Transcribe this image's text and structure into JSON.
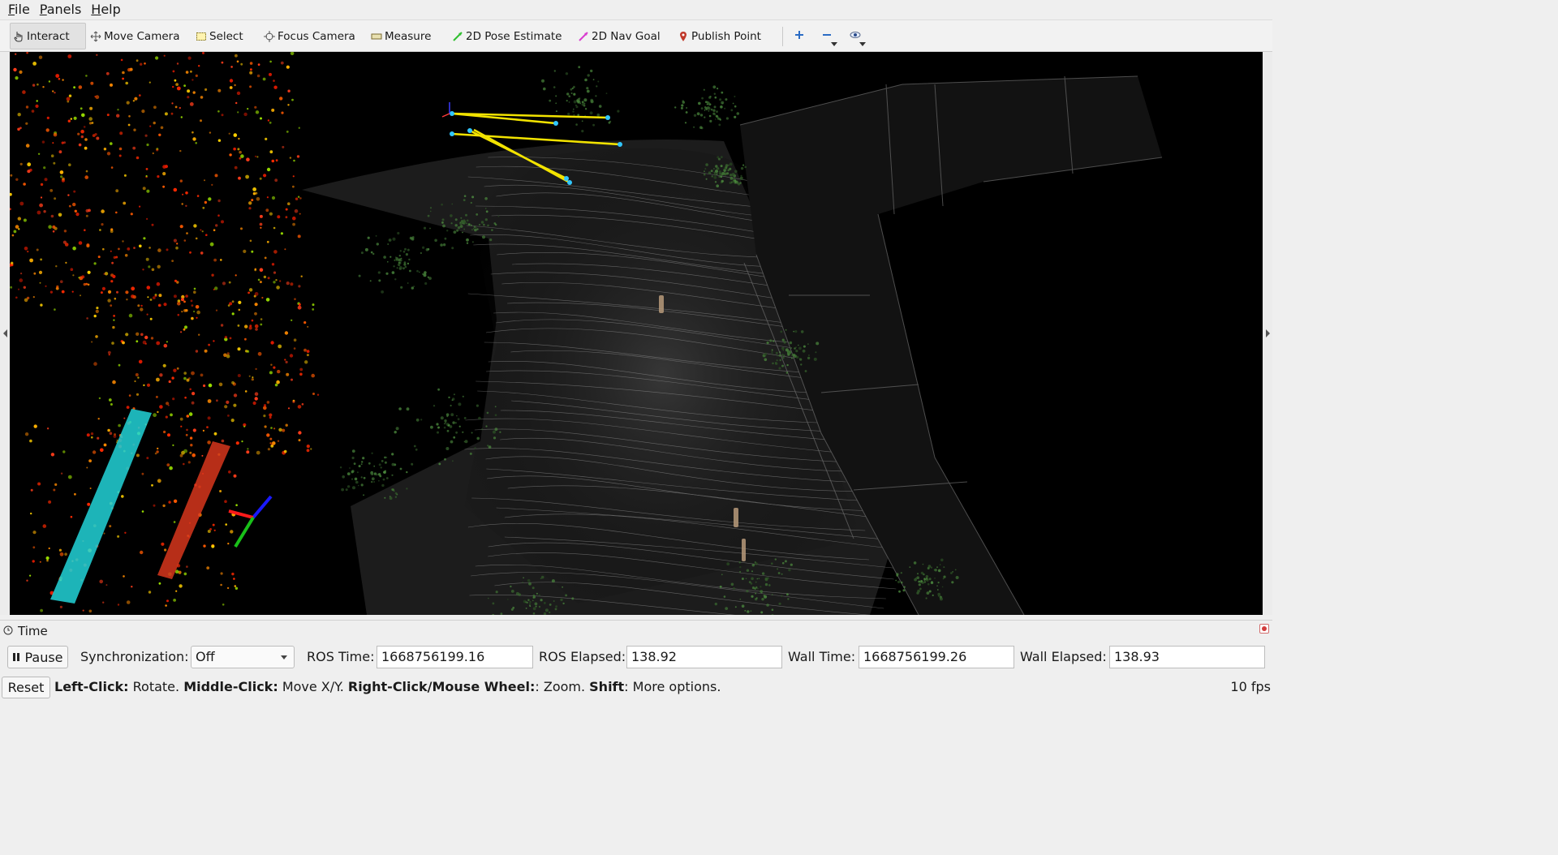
{
  "menu": [
    "File",
    "Panels",
    "Help"
  ],
  "toolbar": {
    "interact": "Interact",
    "move_camera": "Move Camera",
    "select": "Select",
    "focus_camera": "Focus Camera",
    "measure": "Measure",
    "pose_estimate": "2D Pose Estimate",
    "nav_goal": "2D Nav Goal",
    "publish_point": "Publish Point",
    "colors": {
      "pose_estimate": "#2fbf2f",
      "nav_goal": "#d93ccf",
      "publish_point": "#c0392b"
    }
  },
  "time_panel": {
    "title": "Time",
    "pause_label": "Pause",
    "sync_label": "Synchronization:",
    "sync_value": "Off",
    "ros_time_label": "ROS Time:",
    "ros_time": "1668756199.16",
    "ros_elapsed_label": "ROS Elapsed:",
    "ros_elapsed": "138.92",
    "wall_time_label": "Wall Time:",
    "wall_time": "1668756199.26",
    "wall_elapsed_label": "Wall Elapsed:",
    "wall_elapsed": "138.93"
  },
  "status": {
    "reset_label": "Reset",
    "left_click_key": "Left-Click:",
    "left_click_action": "Rotate.",
    "middle_click_key": "Middle-Click:",
    "middle_click_action": "Move X/Y.",
    "right_click_key": "Right-Click/Mouse Wheel:",
    "right_click_action": ": Zoom.",
    "shift_key": "Shift",
    "shift_action": ": More options.",
    "fps": "10 fps"
  }
}
